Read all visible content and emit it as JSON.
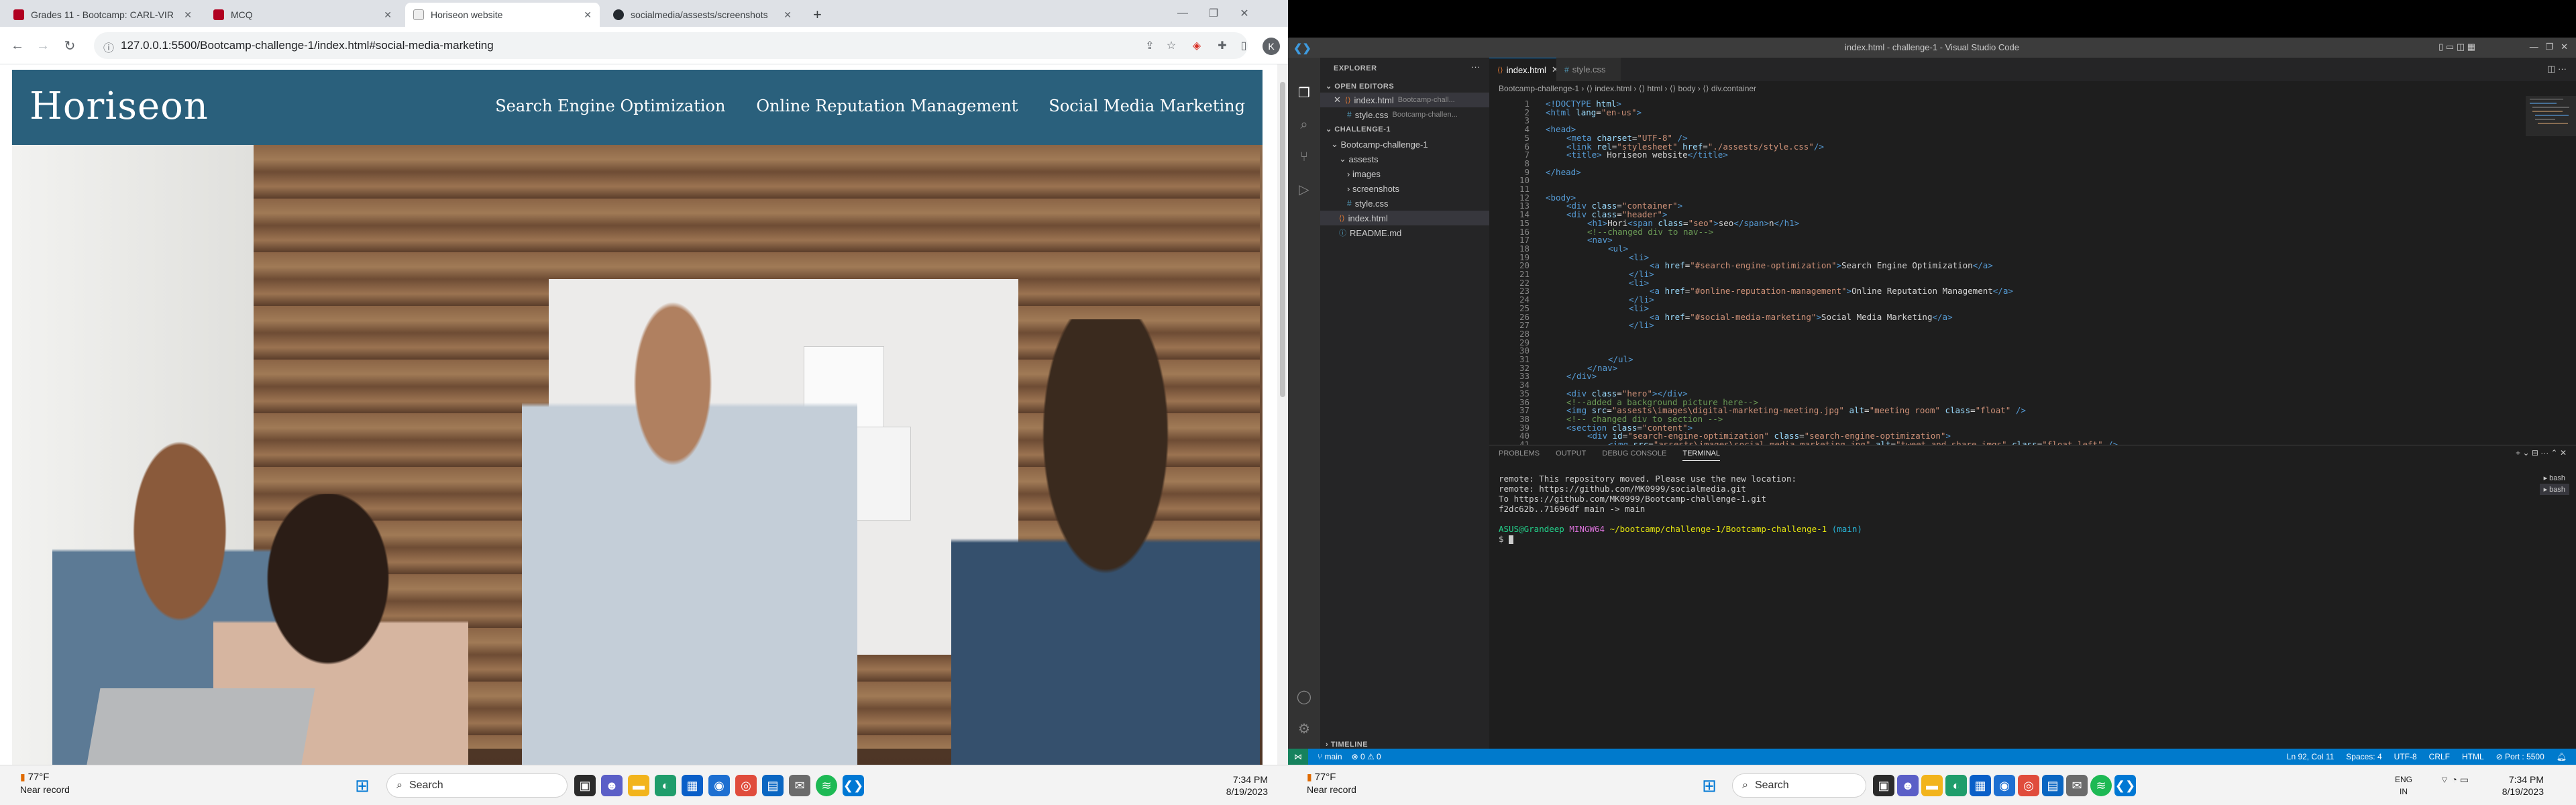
{
  "chrome": {
    "tabs": [
      {
        "title": "Grades 11 - Bootcamp: CARL-VIR",
        "fav_color": "#b00020"
      },
      {
        "title": "MCQ",
        "fav_color": "#b00020"
      },
      {
        "title": "Horiseon website",
        "fav_color": "#5f6368"
      },
      {
        "title": "socialmedia/assests/screenshots",
        "fav_color": "#24292f"
      }
    ],
    "new_tab": "+",
    "url": "127.0.0.1:5500/Bootcamp-challenge-1/index.html#social-media-marketing",
    "profile_initial": "K"
  },
  "site": {
    "logo": "Horiseon",
    "nav": [
      "Search Engine Optimization",
      "Online Reputation Management",
      "Social Media Marketing"
    ]
  },
  "taskbar_left": {
    "weather_temp": "77°F",
    "weather_desc": "Near record",
    "search": "Search",
    "time": "7:34 PM",
    "date": "8/19/2023"
  },
  "taskbar_right": {
    "weather_temp": "77°F",
    "weather_desc": "Near record",
    "search": "Search",
    "lang": "ENG",
    "lang2": "IN",
    "time": "7:34 PM",
    "date": "8/19/2023"
  },
  "vscode": {
    "title": "index.html - challenge-1 - Visual Studio Code",
    "explorer_label": "EXPLORER",
    "open_editors_label": "OPEN EDITORS",
    "open_editors": [
      {
        "name": "index.html",
        "desc": "Bootcamp-chall..."
      },
      {
        "name": "style.css",
        "desc": "Bootcamp-challen..."
      }
    ],
    "project_label": "CHALLENGE-1",
    "tree": [
      "Bootcamp-challenge-1",
      "assests",
      "images",
      "screenshots",
      "style.css",
      "index.html",
      "README.md"
    ],
    "timeline_label": "TIMELINE",
    "editor_tabs": [
      "index.html",
      "style.css"
    ],
    "breadcrumbs": "Bootcamp-challenge-1 › ⟨⟩ index.html › ⟨⟩ html › ⟨⟩ body › ⟨⟩ div.container",
    "panel_tabs": [
      "PROBLEMS",
      "OUTPUT",
      "DEBUG CONSOLE",
      "TERMINAL"
    ],
    "terminal": {
      "line1": "remote: This repository moved. Please use the new location:",
      "line2": "remote:   https://github.com/MK0999/socialmedia.git",
      "line3": "To https://github.com/MK0999/Bootcamp-challenge-1.git",
      "line4": "   f2dc62b..71696df  main -> main",
      "prompt_user": "ASUS@Grandeep",
      "prompt_env": "MINGW64",
      "prompt_path": "~/bootcamp/challenge-1/Bootcamp-challenge-1",
      "prompt_branch": "(main)",
      "prompt_symbol": "$"
    },
    "terminal_list": [
      "bash",
      "bash"
    ],
    "status": {
      "branch": "main",
      "errors": "⊗ 0 ⚠ 0",
      "position": "Ln 92, Col 11",
      "spaces": "Spaces: 4",
      "encoding": "UTF-8",
      "eol": "CRLF",
      "lang": "HTML",
      "port": "⊘ Port : 5500"
    }
  }
}
